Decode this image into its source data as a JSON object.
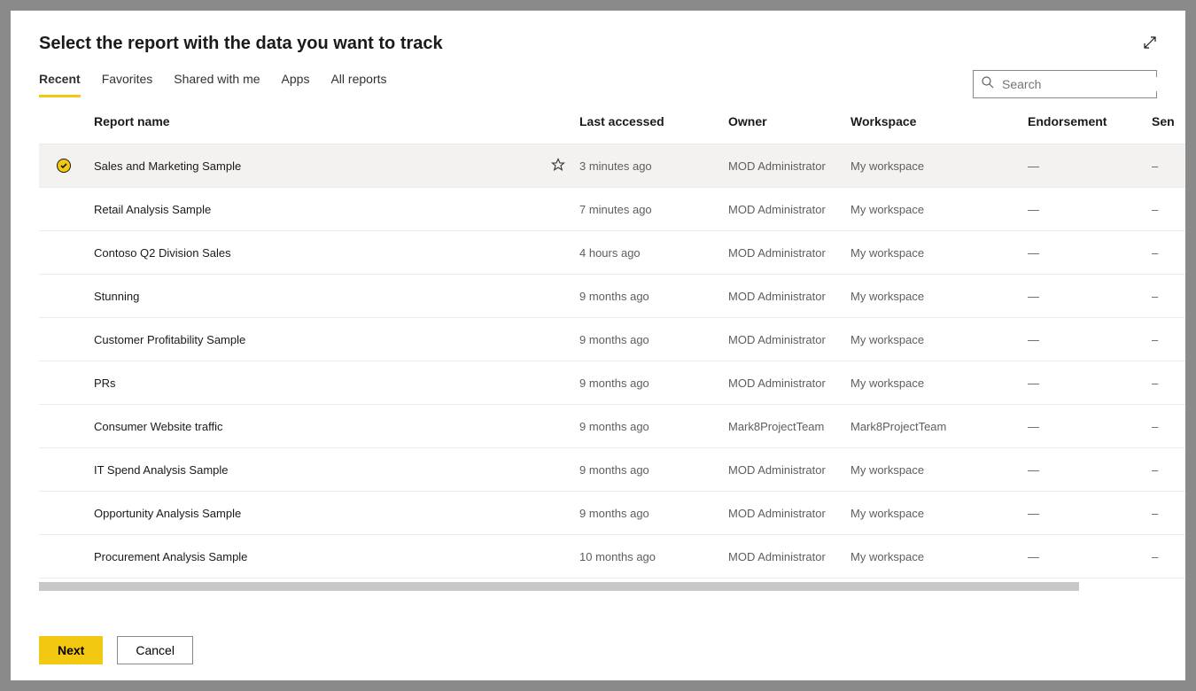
{
  "dialog": {
    "title": "Select the report with the data you want to track"
  },
  "tabs": {
    "recent": "Recent",
    "favorites": "Favorites",
    "shared": "Shared with me",
    "apps": "Apps",
    "all": "All reports"
  },
  "search": {
    "placeholder": "Search"
  },
  "columns": {
    "name": "Report name",
    "accessed": "Last accessed",
    "owner": "Owner",
    "workspace": "Workspace",
    "endorsement": "Endorsement",
    "sensitivity": "Sen"
  },
  "rows": [
    {
      "name": "Sales and Marketing Sample",
      "accessed": "3 minutes ago",
      "owner": "MOD Administrator",
      "workspace": "My workspace",
      "endorsement": "—",
      "sensitivity": "–",
      "selected": true
    },
    {
      "name": "Retail Analysis Sample",
      "accessed": "7 minutes ago",
      "owner": "MOD Administrator",
      "workspace": "My workspace",
      "endorsement": "—",
      "sensitivity": "–",
      "selected": false
    },
    {
      "name": "Contoso Q2 Division Sales",
      "accessed": "4 hours ago",
      "owner": "MOD Administrator",
      "workspace": "My workspace",
      "endorsement": "—",
      "sensitivity": "–",
      "selected": false
    },
    {
      "name": "Stunning",
      "accessed": "9 months ago",
      "owner": "MOD Administrator",
      "workspace": "My workspace",
      "endorsement": "—",
      "sensitivity": "–",
      "selected": false
    },
    {
      "name": "Customer Profitability Sample",
      "accessed": "9 months ago",
      "owner": "MOD Administrator",
      "workspace": "My workspace",
      "endorsement": "—",
      "sensitivity": "–",
      "selected": false
    },
    {
      "name": "PRs",
      "accessed": "9 months ago",
      "owner": "MOD Administrator",
      "workspace": "My workspace",
      "endorsement": "—",
      "sensitivity": "–",
      "selected": false
    },
    {
      "name": "Consumer Website traffic",
      "accessed": "9 months ago",
      "owner": "Mark8ProjectTeam",
      "workspace": "Mark8ProjectTeam",
      "endorsement": "—",
      "sensitivity": "–",
      "selected": false
    },
    {
      "name": "IT Spend Analysis Sample",
      "accessed": "9 months ago",
      "owner": "MOD Administrator",
      "workspace": "My workspace",
      "endorsement": "—",
      "sensitivity": "–",
      "selected": false
    },
    {
      "name": "Opportunity Analysis Sample",
      "accessed": "9 months ago",
      "owner": "MOD Administrator",
      "workspace": "My workspace",
      "endorsement": "—",
      "sensitivity": "–",
      "selected": false
    },
    {
      "name": "Procurement Analysis Sample",
      "accessed": "10 months ago",
      "owner": "MOD Administrator",
      "workspace": "My workspace",
      "endorsement": "—",
      "sensitivity": "–",
      "selected": false
    }
  ],
  "footer": {
    "next": "Next",
    "cancel": "Cancel"
  }
}
